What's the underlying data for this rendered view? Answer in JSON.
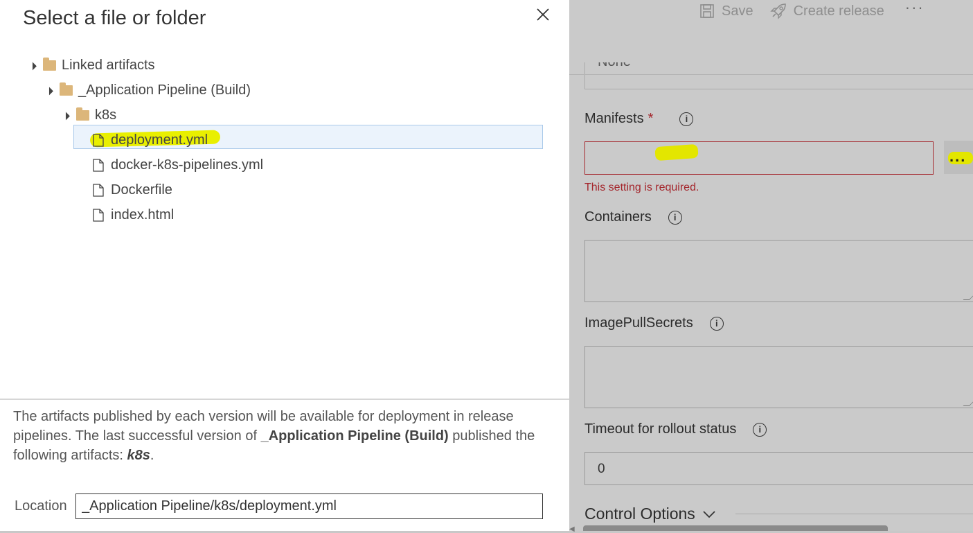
{
  "background": {
    "toolbar": {
      "save_label": "Save",
      "create_release_label": "Create release",
      "more_label": "···"
    },
    "previous_value": "None",
    "manifests": {
      "label": "Manifests",
      "required_marker": "*",
      "value": "",
      "browse_label": "...",
      "error": "This setting is required."
    },
    "containers": {
      "label": "Containers",
      "value": ""
    },
    "image_pull_secrets": {
      "label": "ImagePullSecrets",
      "value": ""
    },
    "timeout": {
      "label": "Timeout for rollout status",
      "value": "0"
    },
    "control_options": {
      "label": "Control Options"
    }
  },
  "dialog": {
    "title": "Select a file or folder",
    "tree": {
      "root": "Linked artifacts",
      "pipeline": "_Application Pipeline (Build)",
      "folder": "k8s",
      "files": [
        "deployment.yml",
        "docker-k8s-pipelines.yml",
        "Dockerfile",
        "index.html"
      ]
    },
    "footer": {
      "text_part1": "The artifacts published by each version will be available for deployment in release pipelines. The last successful version of ",
      "pipeline_name": "_Application Pipeline (Build)",
      "text_part2": " published the following artifacts: ",
      "artifact_name": "k8s",
      "text_part3": "."
    },
    "location": {
      "label": "Location",
      "value": "_Application Pipeline/k8s/deployment.yml"
    }
  },
  "colors": {
    "accent_folder": "#dcb67a",
    "selection_bg": "#ebf3fc",
    "error": "#a4262c",
    "highlighter": "#e3e600"
  }
}
